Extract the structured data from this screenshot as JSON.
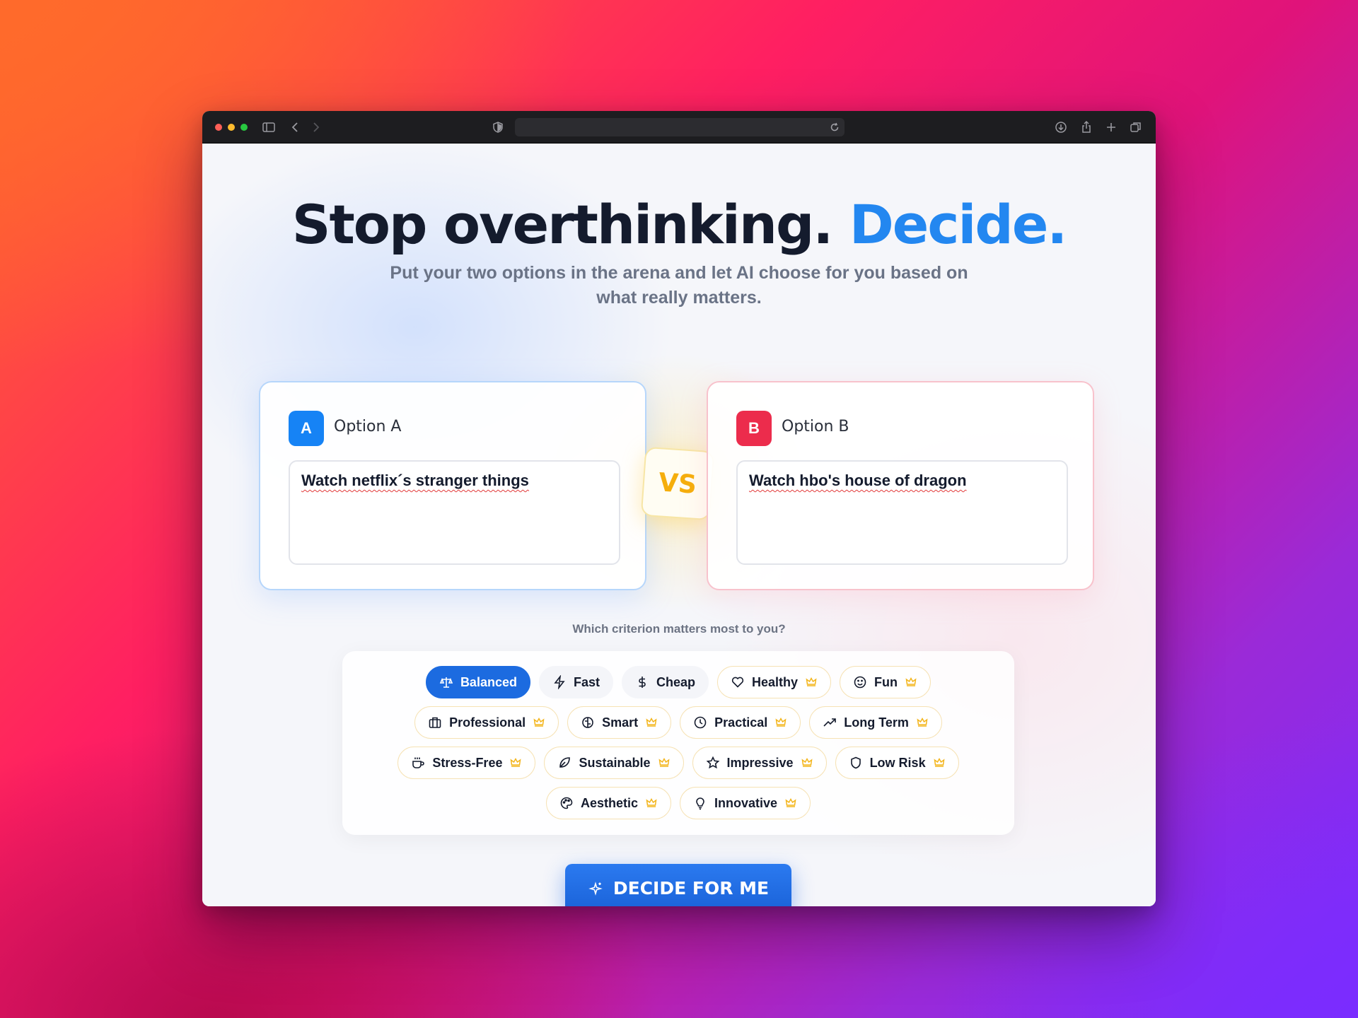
{
  "hero": {
    "title_main": "Stop overthinking.",
    "title_accent": "Decide.",
    "subtitle": "Put your two options in the arena and let AI choose for you based on what really matters."
  },
  "option_a": {
    "badge": "A",
    "label": "Option A",
    "value": "Watch netflix´s stranger things",
    "color": "#1683f5"
  },
  "option_b": {
    "badge": "B",
    "label": "Option B",
    "value": "Watch hbo's house of dragon",
    "color": "#ec2c4c"
  },
  "vs_label": "VS",
  "criteria": {
    "question": "Which criterion matters most to you?",
    "selected": "Balanced",
    "chips": [
      {
        "label": "Balanced",
        "icon": "scale-icon",
        "premium": false
      },
      {
        "label": "Fast",
        "icon": "bolt-icon",
        "premium": false
      },
      {
        "label": "Cheap",
        "icon": "dollar-icon",
        "premium": false
      },
      {
        "label": "Healthy",
        "icon": "heart-icon",
        "premium": true
      },
      {
        "label": "Fun",
        "icon": "smile-icon",
        "premium": true
      },
      {
        "label": "Professional",
        "icon": "briefcase-icon",
        "premium": true
      },
      {
        "label": "Smart",
        "icon": "brain-icon",
        "premium": true
      },
      {
        "label": "Practical",
        "icon": "clock-icon",
        "premium": true
      },
      {
        "label": "Long Term",
        "icon": "trending-up-icon",
        "premium": true
      },
      {
        "label": "Stress-Free",
        "icon": "coffee-icon",
        "premium": true
      },
      {
        "label": "Sustainable",
        "icon": "leaf-icon",
        "premium": true
      },
      {
        "label": "Impressive",
        "icon": "star-icon",
        "premium": true
      },
      {
        "label": "Low Risk",
        "icon": "shield-icon",
        "premium": true
      },
      {
        "label": "Aesthetic",
        "icon": "palette-icon",
        "premium": true
      },
      {
        "label": "Innovative",
        "icon": "lightbulb-icon",
        "premium": true
      }
    ]
  },
  "cta": {
    "label": "DECIDE FOR ME",
    "icon": "sparkles-icon"
  },
  "colors": {
    "accent": "#2387f0",
    "primary_button": "#1c6be0",
    "premium_crown": "#f3b51c"
  }
}
